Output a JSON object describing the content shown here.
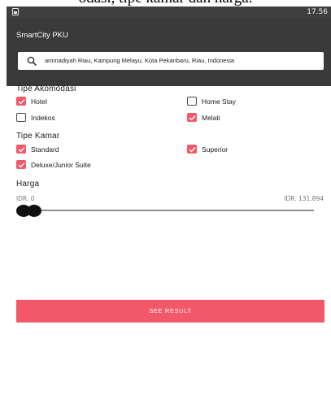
{
  "caption_fragment": "odasi, tipe kamar dan harga.",
  "status_bar": {
    "time": "17.56",
    "icon": "android-notification-icon"
  },
  "app_bar": {
    "title": "SmartCity PKU",
    "search": {
      "icon": "search-icon",
      "value": "Jalan Muhammadiyah Riau, Kampung Melayu, Kota Pekanbaru, Riau, Indonesia",
      "visible_text": "ammadiyah Riau, Kampung Melayu, Kota Pekanbaru, Riau, Indonesia"
    }
  },
  "filters": {
    "accommodation": {
      "label": "Tipe Akomodasi",
      "options": [
        {
          "label": "Hotel",
          "checked": true
        },
        {
          "label": "Home Stay",
          "checked": false
        },
        {
          "label": "Indekos",
          "checked": false
        },
        {
          "label": "Melati",
          "checked": true
        }
      ]
    },
    "room": {
      "label": "Tipe Kamar",
      "options": [
        {
          "label": "Standard",
          "checked": true
        },
        {
          "label": "Superior",
          "checked": true
        },
        {
          "label": "Deluxe/Junior Suite",
          "checked": true
        }
      ]
    },
    "price": {
      "label": "Harga",
      "min_label": "IDR. 0",
      "max_label": "IDR. 131.894",
      "slider_value_fraction": 0.0
    }
  },
  "actions": {
    "see_result": "SEE RESULT"
  },
  "colors": {
    "accent": "#f2576a",
    "app_bar": "#3a3a3a",
    "status_bar": "#3f3f3f"
  }
}
